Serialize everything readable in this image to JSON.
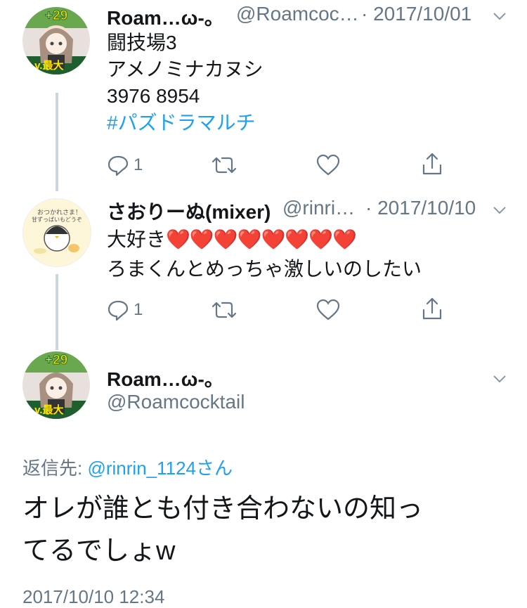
{
  "tweets": [
    {
      "name": "Roam…ω-。",
      "handle": "@Roamcoc…",
      "date": "· 2017/10/01",
      "lines": [
        "闘技場3",
        "アメノミナカヌシ",
        "3976 8954"
      ],
      "hashtag": "#パズドラマルチ",
      "reply_count": "1"
    },
    {
      "name": "さおりーぬ(mixer)",
      "handle": "@rinri…",
      "date": "· 2017/10/10",
      "line1": "大好き",
      "hearts": "❤️❤️❤️❤️❤️❤️❤️❤️",
      "line2": "ろまくんとめっちゃ激しいのしたい",
      "reply_count": "1"
    }
  ],
  "main": {
    "name": "Roam…ω-。",
    "handle": "@Roamcocktail",
    "reply_to_label": "返信先:",
    "reply_to_user": "@rinrin_1124さん",
    "text_line1": "オレが誰とも付き合わないの知っ",
    "text_line2": "てるでしょw",
    "timestamp": "2017/10/10 12:34"
  },
  "avatars": {
    "badge_top": "+29",
    "badge_bottom": "Lv.最大",
    "penguin_top": "おつかれさま！",
    "penguin_mid": "甘ずっぱいもどうぞ"
  },
  "colors": {
    "link": "#1da1f2",
    "muted": "#657786",
    "line": "#ccd6dd"
  }
}
